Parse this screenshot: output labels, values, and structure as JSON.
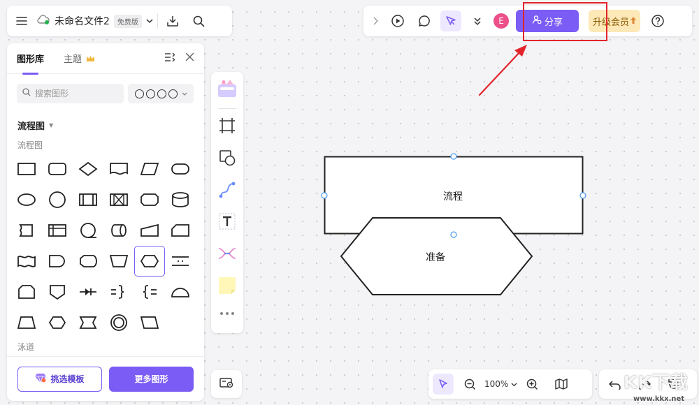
{
  "file": {
    "title": "未命名文件2",
    "badge": "免费版"
  },
  "toolbar": {
    "avatar_letter": "E",
    "share_label": "分享",
    "upgrade_label": "升级会员"
  },
  "library": {
    "tabs": [
      {
        "label": "图形库",
        "active": true
      },
      {
        "label": "主题",
        "active": false
      }
    ],
    "search_placeholder": "搜索图形",
    "section_title": "流程图",
    "sub_label": "流程图",
    "bottom_label": "泳道",
    "template_button": "挑选模板",
    "more_button": "更多图形"
  },
  "canvas": {
    "shapes": [
      {
        "type": "rectangle",
        "label": "流程"
      },
      {
        "type": "hexagon",
        "label": "准备"
      }
    ]
  },
  "zoom": {
    "value": "100%"
  },
  "watermark": {
    "text": "KK下载",
    "url": "www.kkx.net"
  },
  "colors": {
    "accent": "#7b5cf5",
    "highlight": "#e3242b",
    "avatar": "#ec4f8a",
    "upgrade_bg": "#fde8b7"
  }
}
